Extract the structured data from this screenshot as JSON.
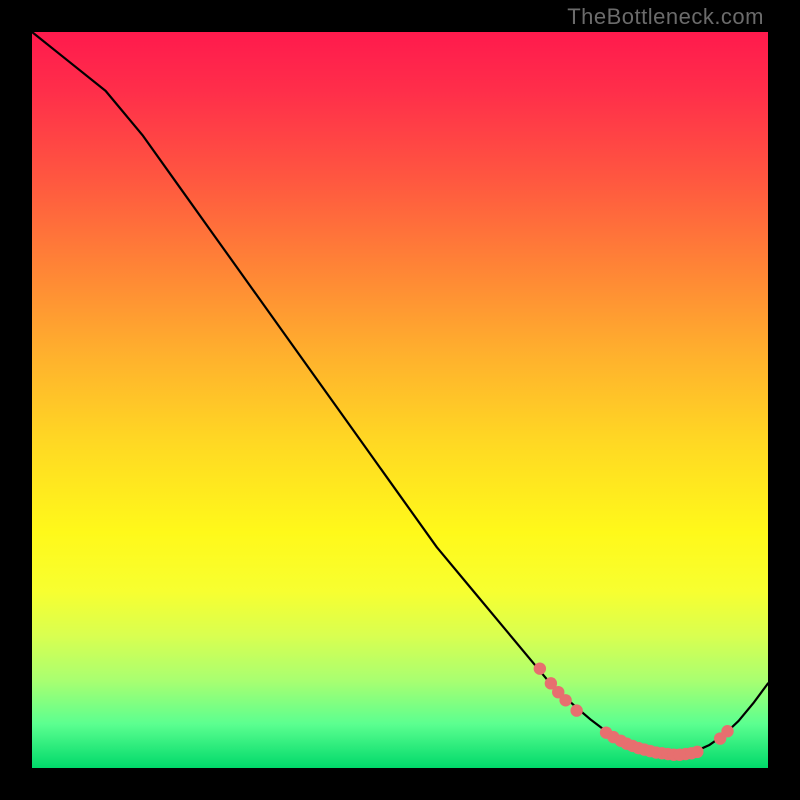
{
  "attribution": "TheBottleneck.com",
  "colors": {
    "dot": "#e76f6f",
    "curve": "#000000"
  },
  "chart_data": {
    "type": "line",
    "title": "",
    "xlabel": "",
    "ylabel": "",
    "xlim": [
      0,
      100
    ],
    "ylim": [
      0,
      100
    ],
    "grid": false,
    "series": [
      {
        "name": "curve",
        "x": [
          0,
          5,
          10,
          15,
          20,
          25,
          30,
          35,
          40,
          45,
          50,
          55,
          60,
          65,
          70,
          72,
          74,
          76,
          78,
          80,
          82,
          84,
          86,
          88,
          90,
          92,
          94,
          96,
          98,
          100
        ],
        "values": [
          100,
          96,
          92,
          86,
          79,
          72,
          65,
          58,
          51,
          44,
          37,
          30,
          24,
          18,
          12,
          10,
          8.2,
          6.5,
          5.0,
          3.8,
          2.8,
          2.2,
          1.8,
          1.8,
          2.2,
          3.1,
          4.5,
          6.4,
          8.8,
          11.5
        ]
      }
    ],
    "markers": [
      {
        "x": 69.0,
        "y": 13.5
      },
      {
        "x": 70.5,
        "y": 11.5
      },
      {
        "x": 71.5,
        "y": 10.3
      },
      {
        "x": 72.5,
        "y": 9.2
      },
      {
        "x": 74.0,
        "y": 7.8
      },
      {
        "x": 78.0,
        "y": 4.8
      },
      {
        "x": 79.0,
        "y": 4.2
      },
      {
        "x": 80.0,
        "y": 3.7
      },
      {
        "x": 80.8,
        "y": 3.3
      },
      {
        "x": 81.6,
        "y": 3.0
      },
      {
        "x": 82.4,
        "y": 2.7
      },
      {
        "x": 83.2,
        "y": 2.5
      },
      {
        "x": 84.0,
        "y": 2.3
      },
      {
        "x": 84.8,
        "y": 2.1
      },
      {
        "x": 85.6,
        "y": 2.0
      },
      {
        "x": 86.4,
        "y": 1.9
      },
      {
        "x": 87.2,
        "y": 1.8
      },
      {
        "x": 88.0,
        "y": 1.8
      },
      {
        "x": 88.8,
        "y": 1.9
      },
      {
        "x": 89.6,
        "y": 2.0
      },
      {
        "x": 90.4,
        "y": 2.2
      },
      {
        "x": 93.5,
        "y": 4.0
      },
      {
        "x": 94.5,
        "y": 5.0
      }
    ]
  }
}
